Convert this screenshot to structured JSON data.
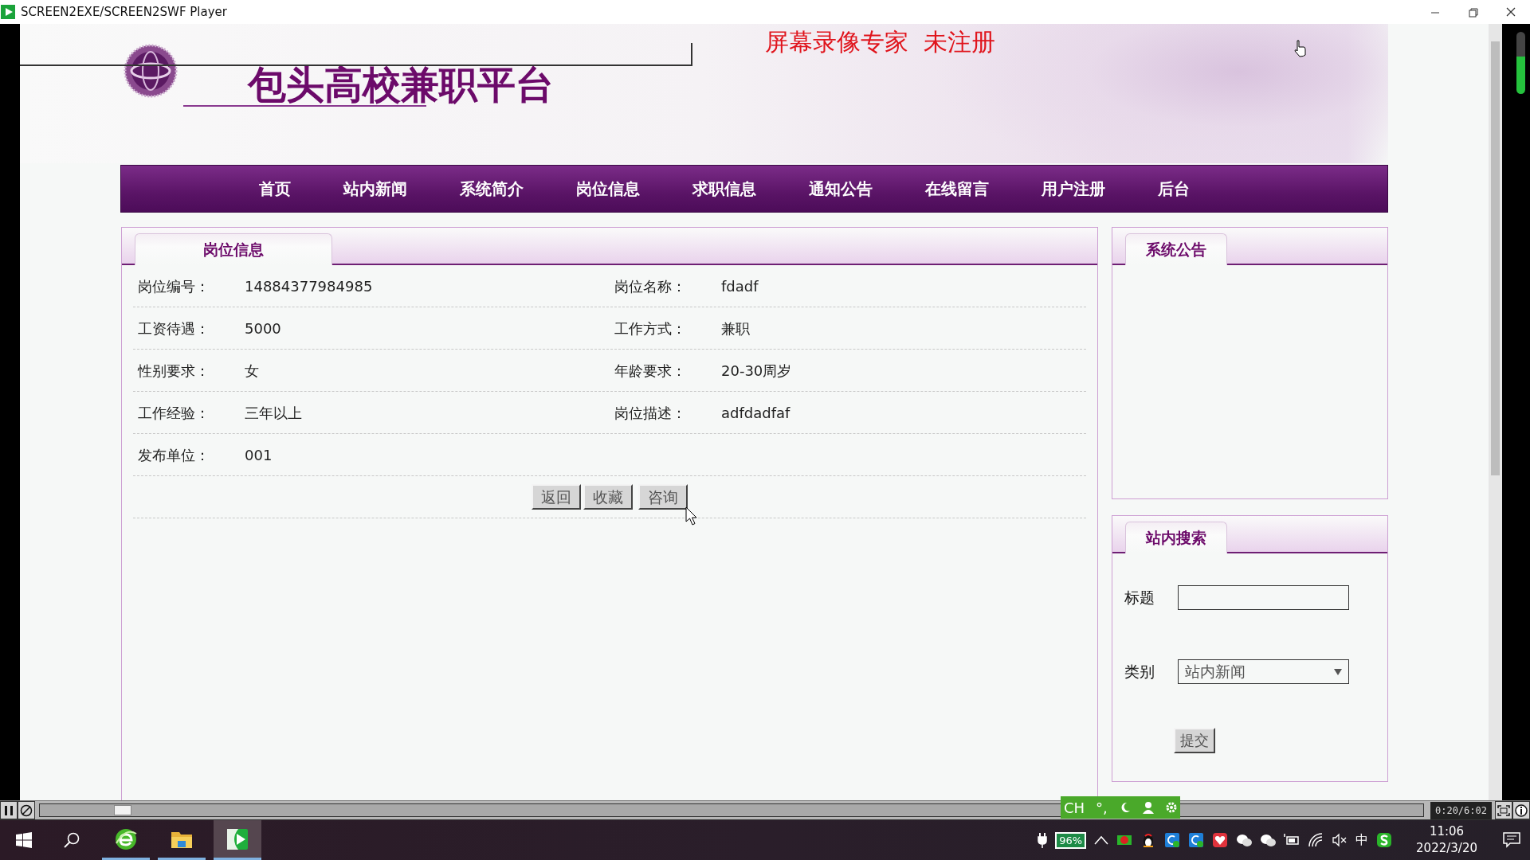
{
  "window": {
    "title": "SCREEN2EXE/SCREEN2SWF Player"
  },
  "recorder_notice": "屏幕录像专家  未注册",
  "site": {
    "title": "包头高校兼职平台",
    "nav": [
      "首页",
      "站内新闻",
      "系统简介",
      "岗位信息",
      "求职信息",
      "通知公告",
      "在线留言",
      "用户注册",
      "后台"
    ]
  },
  "job_panel": {
    "tab": "岗位信息",
    "rows": [
      [
        {
          "label": "岗位编号：",
          "value": "14884377984985"
        },
        {
          "label": "岗位名称：",
          "value": "fdadf"
        }
      ],
      [
        {
          "label": "工资待遇：",
          "value": "5000"
        },
        {
          "label": "工作方式：",
          "value": "兼职"
        }
      ],
      [
        {
          "label": "性别要求：",
          "value": "女"
        },
        {
          "label": "年龄要求：",
          "value": "20-30周岁"
        }
      ],
      [
        {
          "label": "工作经验：",
          "value": "三年以上"
        },
        {
          "label": "岗位描述：",
          "value": "adfdadfaf"
        }
      ],
      [
        {
          "label": "发布单位：",
          "value": "001"
        }
      ]
    ],
    "buttons": [
      "返回",
      "收藏",
      "咨询"
    ]
  },
  "notice_panel": {
    "tab": "系统公告"
  },
  "search_panel": {
    "tab": "站内搜索",
    "fields": [
      {
        "kind": "text",
        "label": "标题"
      },
      {
        "kind": "select",
        "label": "类别",
        "value": "站内新闻"
      }
    ],
    "submit": "提交"
  },
  "player": {
    "seek": {
      "level": 0.06
    },
    "time": "0:20/6:02"
  },
  "ime_bar": {
    "language": "CH",
    "punctuation": "°,"
  },
  "taskbar": {
    "apps": [
      {
        "kind": "browser",
        "selected": false
      },
      {
        "kind": "folder",
        "selected": false
      },
      {
        "kind": "player",
        "selected": true
      }
    ],
    "battery": "96%",
    "input_method": "中",
    "time": "11:06",
    "date": "2022/3/20"
  }
}
